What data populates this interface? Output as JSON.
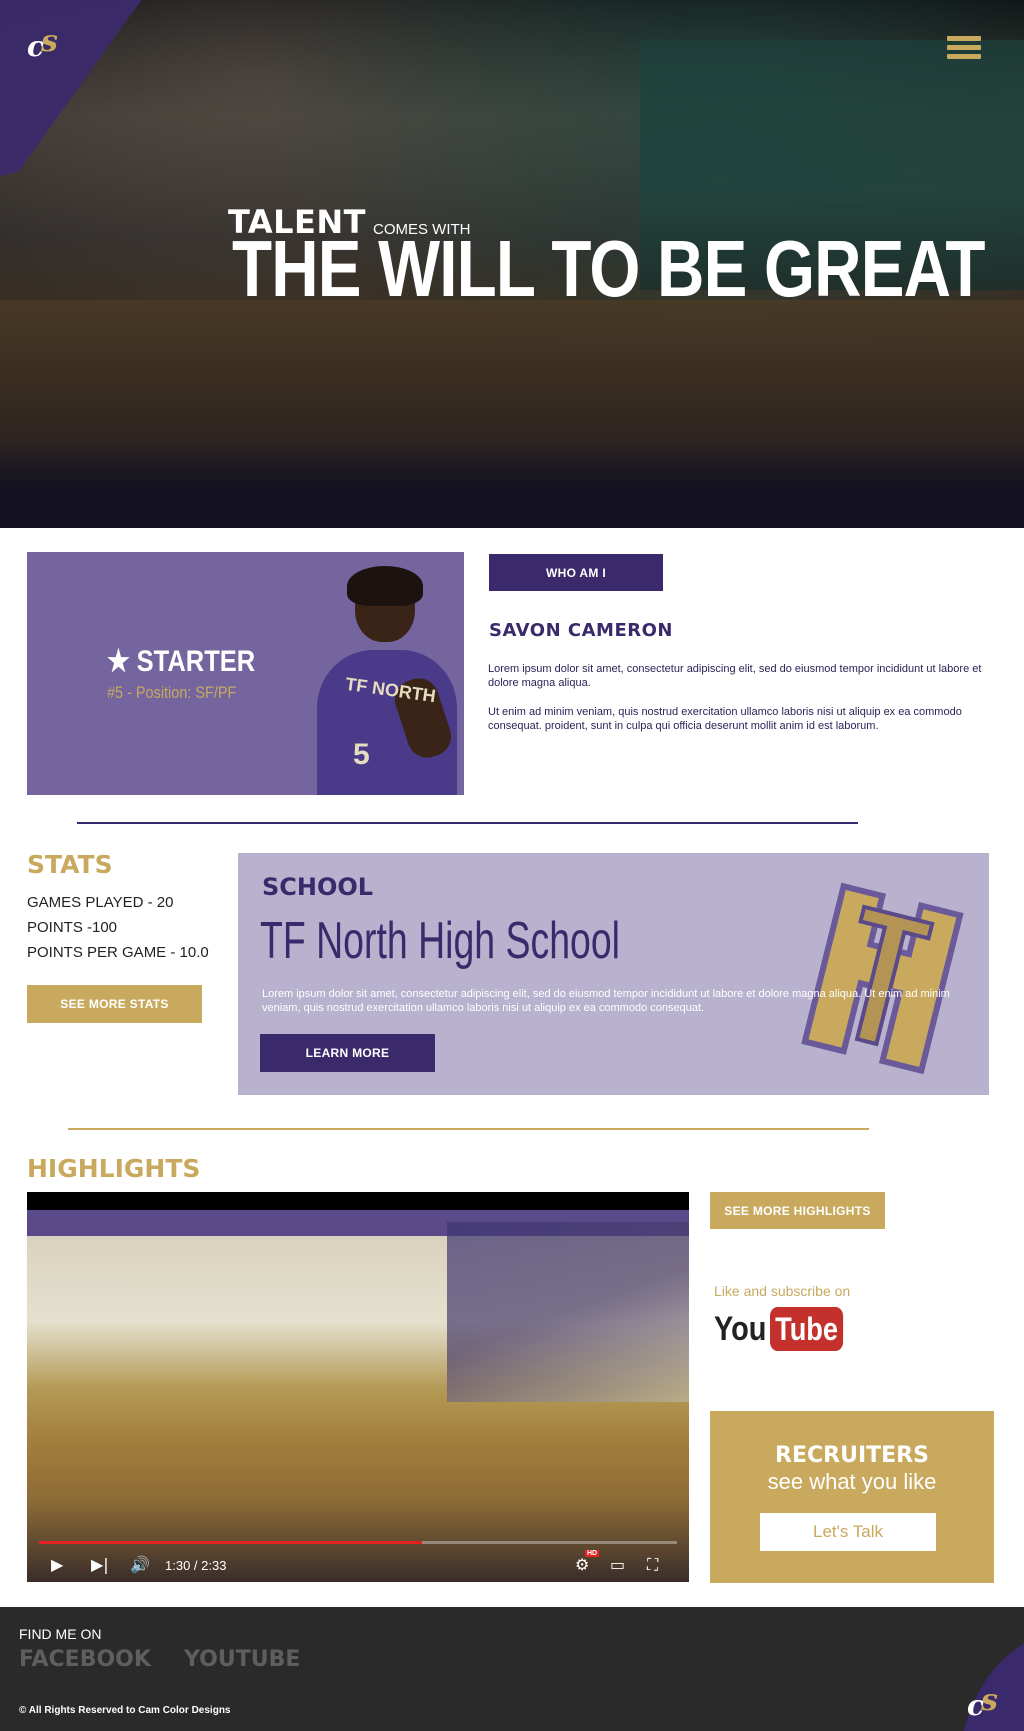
{
  "brand": {
    "logo_letters": "cs",
    "accent_purple": "#3b2a6b",
    "accent_gold": "#c8a95e"
  },
  "header": {
    "menu_icon": "hamburger-icon"
  },
  "hero": {
    "talent": "TALENT",
    "comes_with": "COMES WITH",
    "headline": "THE WILL TO BE GREAT"
  },
  "about": {
    "badge_icon": "star-icon",
    "badge_title": "STARTER",
    "badge_sub": "#5 - Position: SF/PF",
    "jersey_text": "TF NORTH",
    "jersey_number": "5",
    "button": "WHO AM I",
    "name": "SAVON CAMERON",
    "para1": "Lorem ipsum dolor sit amet, consectetur adipiscing elit, sed do eiusmod tempor incididunt ut labore et dolore magna aliqua.",
    "para2": "Ut enim ad minim veniam, quis nostrud exercitation ullamco laboris nisi ut aliquip ex ea commodo consequat. proident, sunt in culpa qui officia deserunt mollit anim id est laborum."
  },
  "stats": {
    "heading": "STATS",
    "lines": [
      "GAMES PLAYED - 20",
      "POINTS -100",
      "POINTS PER GAME - 10.0"
    ],
    "button": "SEE MORE STATS"
  },
  "school": {
    "label": "SCHOOL",
    "name": "TF North High School",
    "description": "Lorem ipsum dolor sit amet, consectetur adipiscing elit, sed do eiusmod tempor incididunt ut labore et dolore magna aliqua. Ut enim ad minim veniam, quis nostrud exercitation ullamco laboris nisi ut aliquip ex ea commodo consequat.",
    "button": "LEARN MORE"
  },
  "highlights": {
    "heading": "HIGHLIGHTS",
    "video": {
      "time": "1:30 / 2:33",
      "progress": 0.6,
      "hd_badge": "HD"
    },
    "more_button": "SEE MORE HIGHLIGHTS",
    "subscribe_text": "Like and subscribe on",
    "youtube_you": "You",
    "youtube_tube": "Tube"
  },
  "recruiters": {
    "title": "RECRUITERS",
    "subtitle": "see what you like",
    "button": "Let's Talk"
  },
  "footer": {
    "find": "FIND ME ON",
    "facebook": "FACEBOOK",
    "youtube": "YOUTUBE",
    "rights": "© All Rights Reserved to Cam Color Designs"
  }
}
